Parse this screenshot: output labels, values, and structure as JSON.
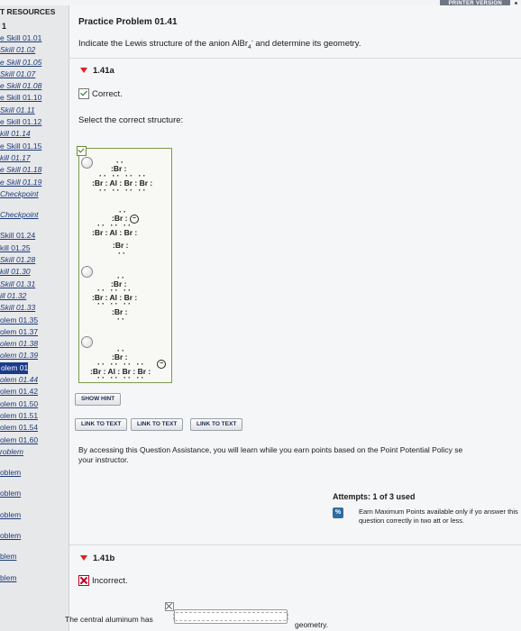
{
  "header": {
    "printer_version": "PRINTER VERSION"
  },
  "sidebar": {
    "title": "T RESOURCES",
    "number": "1",
    "items": [
      {
        "label": "e Skill 01.01",
        "style": "plain"
      },
      {
        "label": "Skill 01.02",
        "style": "ital"
      },
      {
        "label": "e Skill 01.05",
        "style": "ital"
      },
      {
        "label": "Skill 01.07",
        "style": "ital"
      },
      {
        "label": "e Skill 01.08",
        "style": "ital"
      },
      {
        "label": "e Skill 01.10",
        "style": "plain"
      },
      {
        "label": "Skill 01.11",
        "style": "ital"
      },
      {
        "label": "e Skill 01.12",
        "style": "plain"
      },
      {
        "label": "kill 01.14",
        "style": "ital"
      },
      {
        "label": "e Skill 01.15",
        "style": "plain"
      },
      {
        "label": "kill 01.17",
        "style": "ital"
      },
      {
        "label": "e Skill 01.18",
        "style": "ital"
      },
      {
        "label": "e Skill 01.19",
        "style": "ital"
      },
      {
        "label": "Checkpoint",
        "style": "ital",
        "gap": true
      },
      {
        "label": "Checkpoint",
        "style": "ital",
        "gap": true
      },
      {
        "label": "Skill 01.24",
        "style": "plain"
      },
      {
        "label": "kill 01.25",
        "style": "plain"
      },
      {
        "label": "Skill 01.28",
        "style": "ital"
      },
      {
        "label": "kill 01.30",
        "style": "ital"
      },
      {
        "label": "Skill 01.31",
        "style": "ital"
      },
      {
        "label": "ill 01.32",
        "style": "ital"
      },
      {
        "label": "Skill 01.33",
        "style": "ital"
      },
      {
        "label": "olem 01.35",
        "style": "plain"
      },
      {
        "label": "olem 01.37",
        "style": "plain"
      },
      {
        "label": "olem 01.38",
        "style": "ital"
      },
      {
        "label": "olem 01.39",
        "style": "ital"
      },
      {
        "label": "olem 01.41",
        "style": "active"
      },
      {
        "label": "olem 01.44",
        "style": "ital"
      },
      {
        "label": "olem 01.42",
        "style": "plain"
      },
      {
        "label": "olem 01.50",
        "style": "plain"
      },
      {
        "label": "olem 01.51",
        "style": "plain"
      },
      {
        "label": "olem 01.54",
        "style": "plain"
      },
      {
        "label": "olem 01.60",
        "style": "plain"
      },
      {
        "label": "roblem",
        "style": "ital",
        "gap": true
      },
      {
        "label": "oblem",
        "style": "plain",
        "gap": true
      },
      {
        "label": "oblem",
        "style": "plain",
        "gap": true
      },
      {
        "label": "oblem",
        "style": "plain",
        "gap": true
      },
      {
        "label": "oblem",
        "style": "plain",
        "gap": true
      },
      {
        "label": "blem",
        "style": "plain",
        "gap": true
      },
      {
        "label": "blem",
        "style": "plain"
      }
    ]
  },
  "problem": {
    "title": "Practice Problem 01.41",
    "text_before": "Indicate the Lewis structure of the anion AlBr",
    "sub": "4",
    "sup": "-",
    "text_after": " and determine its geometry."
  },
  "part_a": {
    "label": "1.41a",
    "status": "Correct.",
    "select_prompt": "Select the correct structure:",
    "structures": [
      {
        "top": ":Br :",
        "mid": ":Br : Al : Br : Br :",
        "bot": ""
      },
      {
        "top": ":Br : ",
        "mid": ":Br : Al : Br :",
        "bot": ":Br :"
      },
      {
        "top": ":Br :",
        "mid": ":Br : Al : Br :",
        "bot": ":Br :"
      },
      {
        "top": ":Br :",
        "mid": ":Br : Al : Br : Br :",
        "bot": ""
      }
    ],
    "charge_symbol": "−"
  },
  "buttons": {
    "show_hint": "SHOW HINT",
    "link1": "LINK TO TEXT",
    "link2": "LINK TO TEXT",
    "link3": "LINK TO TEXT"
  },
  "assistance": {
    "text": "By accessing this Question Assistance, you will learn while you earn points based on the Point Potential Policy se",
    "text2": "your instructor."
  },
  "attempts": {
    "label": "Attempts: 1 of 3 used",
    "badge": "%",
    "max_text": "Earn Maximum Points available only if yo answer this question correctly in two att or less."
  },
  "part_b": {
    "label": "1.41b",
    "status": "Incorrect.",
    "prompt": "The central aluminum has",
    "suffix": "geometry.",
    "input_value": ""
  }
}
